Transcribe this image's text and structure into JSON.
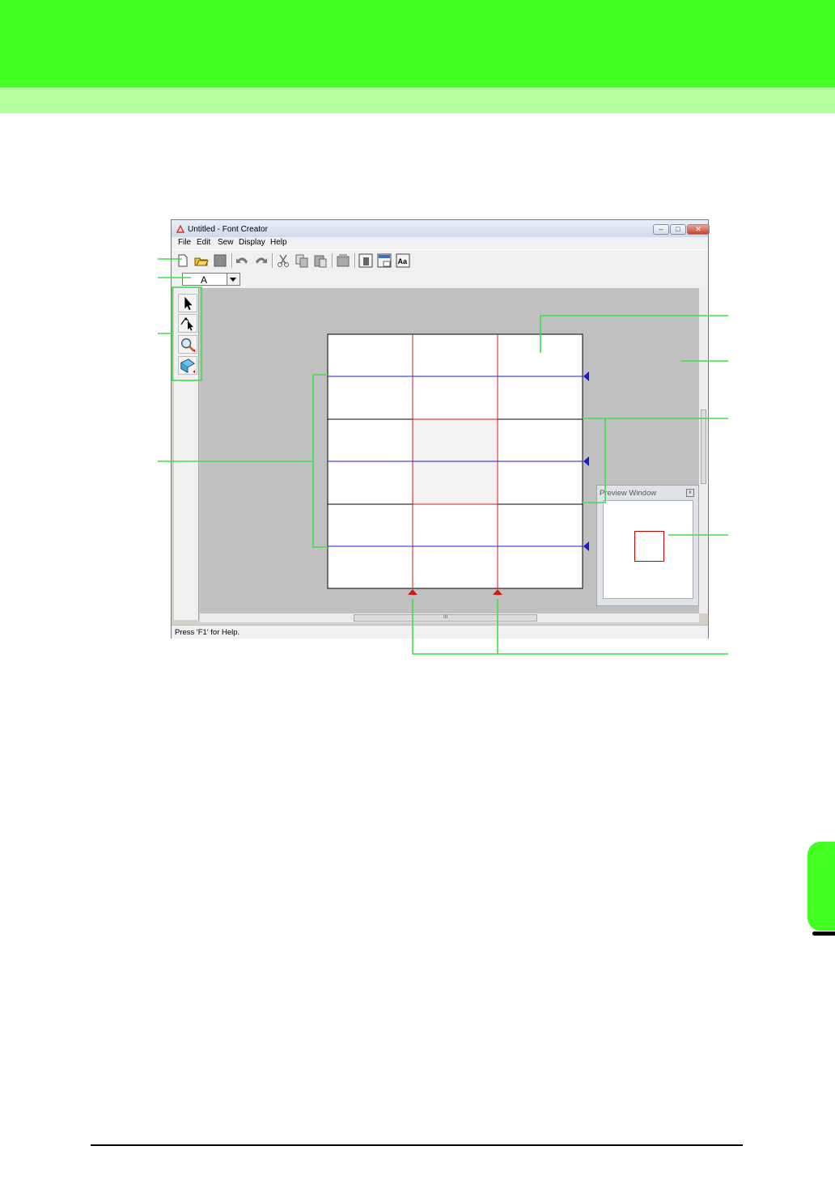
{
  "window": {
    "title": "Untitled - Font Creator",
    "menu": [
      "File",
      "Edit",
      "Sew",
      "Display",
      "Help"
    ],
    "char_value": "A",
    "status_text": "Press 'F1' for Help.",
    "preview_title": "Preview Window",
    "minimize_glyph": "–",
    "maximize_glyph": "□",
    "close_glyph": "✕",
    "preview_close_glyph": "x",
    "scroll_thumb_glyph": "III",
    "toolbar_icons": [
      "new-file-icon",
      "open-folder-icon",
      "save-icon",
      "undo-icon",
      "redo-icon",
      "cut-icon",
      "copy-icon",
      "paste-icon",
      "reference-image-icon",
      "background-icon",
      "preview-icon",
      "text-font-icon"
    ],
    "tools": [
      "select-tool-icon",
      "point-edit-tool-icon",
      "zoom-tool-icon",
      "sew-type-tool-icon"
    ]
  },
  "colors": {
    "green": "#44ff22",
    "light_green": "#b3ffa0",
    "callout": "#3ddf48",
    "guide_blue": "#1b1bd0",
    "guide_red": "#d01b1b"
  }
}
